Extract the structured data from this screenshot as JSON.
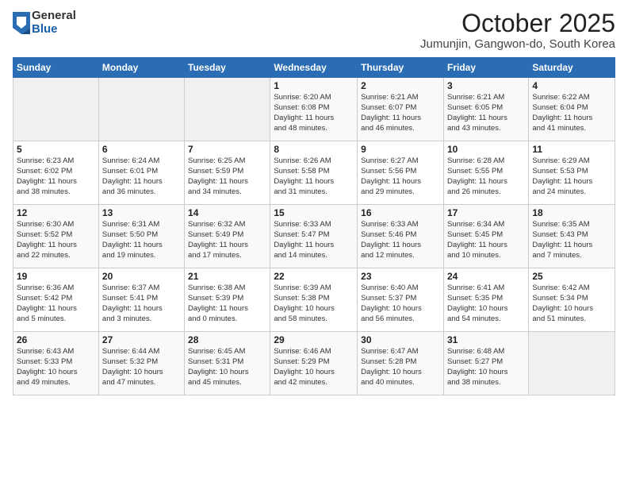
{
  "logo": {
    "general": "General",
    "blue": "Blue"
  },
  "header": {
    "title": "October 2025",
    "location": "Jumunjin, Gangwon-do, South Korea"
  },
  "weekdays": [
    "Sunday",
    "Monday",
    "Tuesday",
    "Wednesday",
    "Thursday",
    "Friday",
    "Saturday"
  ],
  "weeks": [
    [
      {
        "day": "",
        "info": ""
      },
      {
        "day": "",
        "info": ""
      },
      {
        "day": "",
        "info": ""
      },
      {
        "day": "1",
        "info": "Sunrise: 6:20 AM\nSunset: 6:08 PM\nDaylight: 11 hours\nand 48 minutes."
      },
      {
        "day": "2",
        "info": "Sunrise: 6:21 AM\nSunset: 6:07 PM\nDaylight: 11 hours\nand 46 minutes."
      },
      {
        "day": "3",
        "info": "Sunrise: 6:21 AM\nSunset: 6:05 PM\nDaylight: 11 hours\nand 43 minutes."
      },
      {
        "day": "4",
        "info": "Sunrise: 6:22 AM\nSunset: 6:04 PM\nDaylight: 11 hours\nand 41 minutes."
      }
    ],
    [
      {
        "day": "5",
        "info": "Sunrise: 6:23 AM\nSunset: 6:02 PM\nDaylight: 11 hours\nand 38 minutes."
      },
      {
        "day": "6",
        "info": "Sunrise: 6:24 AM\nSunset: 6:01 PM\nDaylight: 11 hours\nand 36 minutes."
      },
      {
        "day": "7",
        "info": "Sunrise: 6:25 AM\nSunset: 5:59 PM\nDaylight: 11 hours\nand 34 minutes."
      },
      {
        "day": "8",
        "info": "Sunrise: 6:26 AM\nSunset: 5:58 PM\nDaylight: 11 hours\nand 31 minutes."
      },
      {
        "day": "9",
        "info": "Sunrise: 6:27 AM\nSunset: 5:56 PM\nDaylight: 11 hours\nand 29 minutes."
      },
      {
        "day": "10",
        "info": "Sunrise: 6:28 AM\nSunset: 5:55 PM\nDaylight: 11 hours\nand 26 minutes."
      },
      {
        "day": "11",
        "info": "Sunrise: 6:29 AM\nSunset: 5:53 PM\nDaylight: 11 hours\nand 24 minutes."
      }
    ],
    [
      {
        "day": "12",
        "info": "Sunrise: 6:30 AM\nSunset: 5:52 PM\nDaylight: 11 hours\nand 22 minutes."
      },
      {
        "day": "13",
        "info": "Sunrise: 6:31 AM\nSunset: 5:50 PM\nDaylight: 11 hours\nand 19 minutes."
      },
      {
        "day": "14",
        "info": "Sunrise: 6:32 AM\nSunset: 5:49 PM\nDaylight: 11 hours\nand 17 minutes."
      },
      {
        "day": "15",
        "info": "Sunrise: 6:33 AM\nSunset: 5:47 PM\nDaylight: 11 hours\nand 14 minutes."
      },
      {
        "day": "16",
        "info": "Sunrise: 6:33 AM\nSunset: 5:46 PM\nDaylight: 11 hours\nand 12 minutes."
      },
      {
        "day": "17",
        "info": "Sunrise: 6:34 AM\nSunset: 5:45 PM\nDaylight: 11 hours\nand 10 minutes."
      },
      {
        "day": "18",
        "info": "Sunrise: 6:35 AM\nSunset: 5:43 PM\nDaylight: 11 hours\nand 7 minutes."
      }
    ],
    [
      {
        "day": "19",
        "info": "Sunrise: 6:36 AM\nSunset: 5:42 PM\nDaylight: 11 hours\nand 5 minutes."
      },
      {
        "day": "20",
        "info": "Sunrise: 6:37 AM\nSunset: 5:41 PM\nDaylight: 11 hours\nand 3 minutes."
      },
      {
        "day": "21",
        "info": "Sunrise: 6:38 AM\nSunset: 5:39 PM\nDaylight: 11 hours\nand 0 minutes."
      },
      {
        "day": "22",
        "info": "Sunrise: 6:39 AM\nSunset: 5:38 PM\nDaylight: 10 hours\nand 58 minutes."
      },
      {
        "day": "23",
        "info": "Sunrise: 6:40 AM\nSunset: 5:37 PM\nDaylight: 10 hours\nand 56 minutes."
      },
      {
        "day": "24",
        "info": "Sunrise: 6:41 AM\nSunset: 5:35 PM\nDaylight: 10 hours\nand 54 minutes."
      },
      {
        "day": "25",
        "info": "Sunrise: 6:42 AM\nSunset: 5:34 PM\nDaylight: 10 hours\nand 51 minutes."
      }
    ],
    [
      {
        "day": "26",
        "info": "Sunrise: 6:43 AM\nSunset: 5:33 PM\nDaylight: 10 hours\nand 49 minutes."
      },
      {
        "day": "27",
        "info": "Sunrise: 6:44 AM\nSunset: 5:32 PM\nDaylight: 10 hours\nand 47 minutes."
      },
      {
        "day": "28",
        "info": "Sunrise: 6:45 AM\nSunset: 5:31 PM\nDaylight: 10 hours\nand 45 minutes."
      },
      {
        "day": "29",
        "info": "Sunrise: 6:46 AM\nSunset: 5:29 PM\nDaylight: 10 hours\nand 42 minutes."
      },
      {
        "day": "30",
        "info": "Sunrise: 6:47 AM\nSunset: 5:28 PM\nDaylight: 10 hours\nand 40 minutes."
      },
      {
        "day": "31",
        "info": "Sunrise: 6:48 AM\nSunset: 5:27 PM\nDaylight: 10 hours\nand 38 minutes."
      },
      {
        "day": "",
        "info": ""
      }
    ]
  ]
}
